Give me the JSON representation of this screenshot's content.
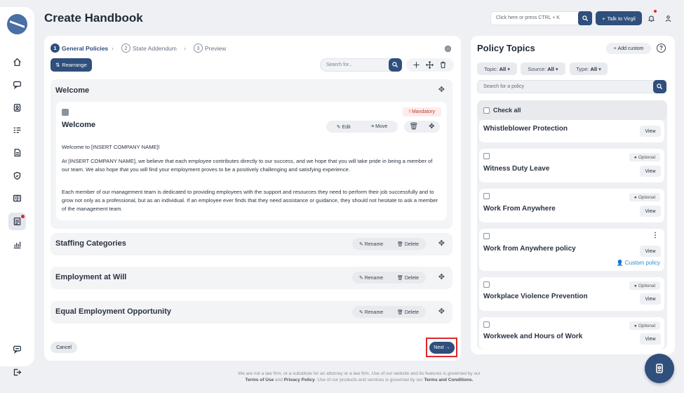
{
  "header": {
    "title": "Create Handbook",
    "search_placeholder": "Click here or press CTRL + K",
    "virgil_label": "Talk to Virgil"
  },
  "sidebar": {
    "icons": [
      "home-icon",
      "chat-icon",
      "id-card-icon",
      "checklist-icon",
      "document-icon",
      "shield-icon",
      "book-icon",
      "handbook-icon",
      "analytics-icon"
    ],
    "bottom_icons": [
      "feedback-icon",
      "logout-icon"
    ]
  },
  "steps": [
    {
      "num": "1",
      "label": "General Policies"
    },
    {
      "num": "2",
      "label": "State Addendum"
    },
    {
      "num": "3",
      "label": "Preview"
    }
  ],
  "toolbar": {
    "rearrange_label": "Rearrange",
    "search_placeholder": "Search for..."
  },
  "welcome": {
    "section_title": "Welcome",
    "policy_title": "Welcome",
    "badge": "Mandatory",
    "edit_label": "Edit",
    "move_label": "Move",
    "paragraphs": [
      "Welcome to [INSERT COMPANY NAME]!",
      "At [INSERT COMPANY NAME], we believe that each employee contributes directly to our success, and we hope that you will take pride in being a member of our team. We also hope that you will find your employment proves to be a positively challenging and satisfying experience.",
      "Each member of our management team is dedicated to providing employees with the support and resources they need to perform their job successfully and to grow not only as a professional, but as an individual. If an employee ever finds that they need assistance or guidance, they should not hesitate to ask a member of the management team."
    ]
  },
  "sections": [
    {
      "title": "Staffing Categories",
      "rename": "Rename",
      "delete": "Delete"
    },
    {
      "title": "Employment at Will",
      "rename": "Rename",
      "delete": "Delete"
    },
    {
      "title": "Equal Employment Opportunity",
      "rename": "Rename",
      "delete": "Delete"
    }
  ],
  "footer_actions": {
    "cancel": "Cancel",
    "next": "Next"
  },
  "policy_topics": {
    "title": "Policy Topics",
    "add_custom": "Add custom",
    "filters": [
      {
        "label": "Topic:",
        "value": "All"
      },
      {
        "label": "Source:",
        "value": "All"
      },
      {
        "label": "Type:",
        "value": "All"
      }
    ],
    "search_placeholder": "Search for a policy",
    "check_all": "Check all",
    "items": [
      {
        "title": "Whistleblower Protection",
        "tag": "",
        "view": "View",
        "custom": ""
      },
      {
        "title": "Witness Duty Leave",
        "tag": "Optional",
        "view": "View",
        "custom": ""
      },
      {
        "title": "Work From Anywhere",
        "tag": "Optional",
        "view": "View",
        "custom": ""
      },
      {
        "title": "Work from Anywhere policy",
        "tag": "",
        "view": "View",
        "custom": "Custom policy"
      },
      {
        "title": "Workplace Violence Prevention",
        "tag": "Optional",
        "view": "View",
        "custom": ""
      },
      {
        "title": "Workweek and Hours of Work",
        "tag": "Optional",
        "view": "View",
        "custom": ""
      }
    ]
  },
  "footer": {
    "line1": "We are not a law firm, or a substitute for an attorney or a law firm. Use of our website and its features is governed by our",
    "terms": "Terms of Use",
    "and": "and",
    "privacy": "Privacy Policy",
    "line2": ". Use of our products and services is governed by our",
    "conditions": "Terms and Conditions."
  },
  "colors": {
    "primary": "#2f4f7c",
    "alert": "#e0272b",
    "link": "#2a8ec9"
  }
}
